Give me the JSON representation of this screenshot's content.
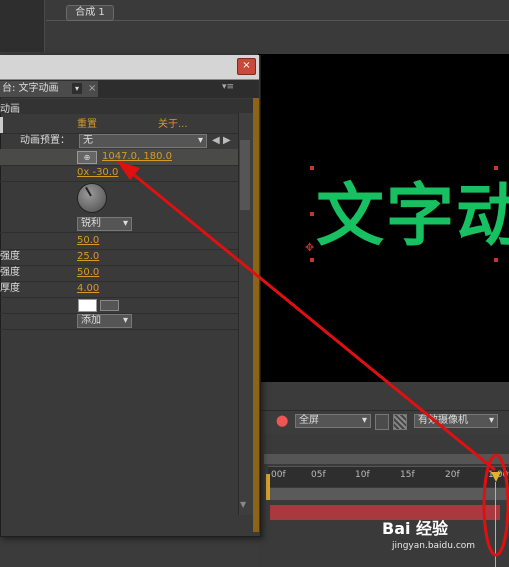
{
  "composition_tab": "合成 1",
  "panel": {
    "tab_label": "台: 文字动画",
    "subheader": "动画",
    "reset_label": "重置",
    "about_label": "关于...",
    "preset_label": "动画预置：",
    "preset_value": "无",
    "position_value": "1047.0, 180.0",
    "rotation_value": "0x -30.0",
    "sharp_dropdown": "锐利",
    "value_1": "50.0",
    "row_label_2": "强度",
    "value_2": "25.0",
    "row_label_3": "强度",
    "value_3": "50.0",
    "row_label_4": "厚度",
    "value_4": "4.00",
    "add_dropdown": "添加",
    "close_glyph": "×"
  },
  "viewer": {
    "text": "文字动",
    "zoom_dropdown": "全屏",
    "camera_dropdown": "有效摄像机"
  },
  "timeline": {
    "ticks": [
      "00f",
      "05f",
      "10f",
      "15f",
      "20f",
      "1:00f"
    ]
  },
  "watermark": {
    "brand": "Bai 经验",
    "url": "jingyan.baidu.com"
  },
  "colors": {
    "text_green": "#17c060",
    "value_orange": "#d89a25",
    "arrow_red": "#e01010",
    "layer_bar": "#a7393f"
  }
}
